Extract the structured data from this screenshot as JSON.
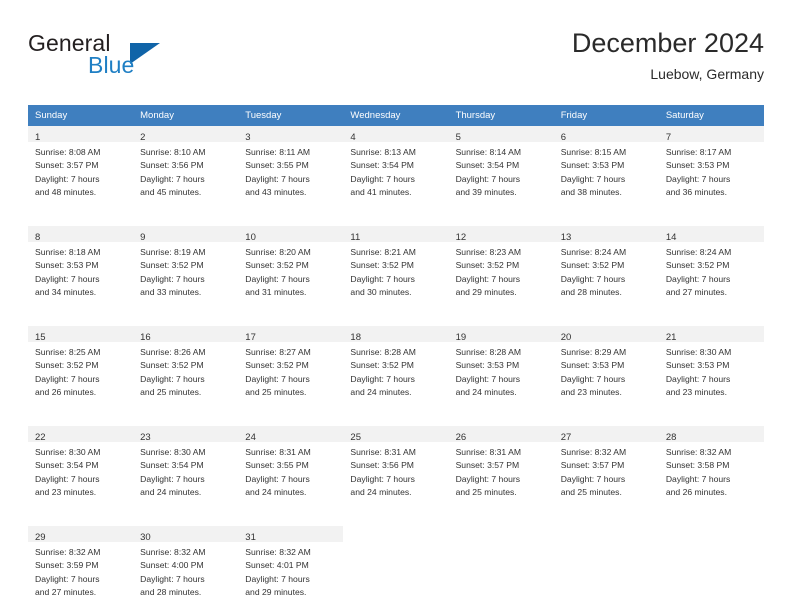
{
  "logo": {
    "word1": "General",
    "word2": "Blue",
    "triangle_color": "#1064a8",
    "blue_color": "#1f7fc4"
  },
  "header": {
    "title": "December 2024",
    "subtitle": "Luebow, Germany"
  },
  "theme": {
    "header_row_bg": "#3f7fbf",
    "daynum_band_bg": "#f2f2f2",
    "text_color": "#333333"
  },
  "weekdays": [
    "Sunday",
    "Monday",
    "Tuesday",
    "Wednesday",
    "Thursday",
    "Friday",
    "Saturday"
  ],
  "weeks": [
    [
      {
        "day": "1",
        "sunrise": "Sunrise: 8:08 AM",
        "sunset": "Sunset: 3:57 PM",
        "daylight1": "Daylight: 7 hours",
        "daylight2": "and 48 minutes."
      },
      {
        "day": "2",
        "sunrise": "Sunrise: 8:10 AM",
        "sunset": "Sunset: 3:56 PM",
        "daylight1": "Daylight: 7 hours",
        "daylight2": "and 45 minutes."
      },
      {
        "day": "3",
        "sunrise": "Sunrise: 8:11 AM",
        "sunset": "Sunset: 3:55 PM",
        "daylight1": "Daylight: 7 hours",
        "daylight2": "and 43 minutes."
      },
      {
        "day": "4",
        "sunrise": "Sunrise: 8:13 AM",
        "sunset": "Sunset: 3:54 PM",
        "daylight1": "Daylight: 7 hours",
        "daylight2": "and 41 minutes."
      },
      {
        "day": "5",
        "sunrise": "Sunrise: 8:14 AM",
        "sunset": "Sunset: 3:54 PM",
        "daylight1": "Daylight: 7 hours",
        "daylight2": "and 39 minutes."
      },
      {
        "day": "6",
        "sunrise": "Sunrise: 8:15 AM",
        "sunset": "Sunset: 3:53 PM",
        "daylight1": "Daylight: 7 hours",
        "daylight2": "and 38 minutes."
      },
      {
        "day": "7",
        "sunrise": "Sunrise: 8:17 AM",
        "sunset": "Sunset: 3:53 PM",
        "daylight1": "Daylight: 7 hours",
        "daylight2": "and 36 minutes."
      }
    ],
    [
      {
        "day": "8",
        "sunrise": "Sunrise: 8:18 AM",
        "sunset": "Sunset: 3:53 PM",
        "daylight1": "Daylight: 7 hours",
        "daylight2": "and 34 minutes."
      },
      {
        "day": "9",
        "sunrise": "Sunrise: 8:19 AM",
        "sunset": "Sunset: 3:52 PM",
        "daylight1": "Daylight: 7 hours",
        "daylight2": "and 33 minutes."
      },
      {
        "day": "10",
        "sunrise": "Sunrise: 8:20 AM",
        "sunset": "Sunset: 3:52 PM",
        "daylight1": "Daylight: 7 hours",
        "daylight2": "and 31 minutes."
      },
      {
        "day": "11",
        "sunrise": "Sunrise: 8:21 AM",
        "sunset": "Sunset: 3:52 PM",
        "daylight1": "Daylight: 7 hours",
        "daylight2": "and 30 minutes."
      },
      {
        "day": "12",
        "sunrise": "Sunrise: 8:23 AM",
        "sunset": "Sunset: 3:52 PM",
        "daylight1": "Daylight: 7 hours",
        "daylight2": "and 29 minutes."
      },
      {
        "day": "13",
        "sunrise": "Sunrise: 8:24 AM",
        "sunset": "Sunset: 3:52 PM",
        "daylight1": "Daylight: 7 hours",
        "daylight2": "and 28 minutes."
      },
      {
        "day": "14",
        "sunrise": "Sunrise: 8:24 AM",
        "sunset": "Sunset: 3:52 PM",
        "daylight1": "Daylight: 7 hours",
        "daylight2": "and 27 minutes."
      }
    ],
    [
      {
        "day": "15",
        "sunrise": "Sunrise: 8:25 AM",
        "sunset": "Sunset: 3:52 PM",
        "daylight1": "Daylight: 7 hours",
        "daylight2": "and 26 minutes."
      },
      {
        "day": "16",
        "sunrise": "Sunrise: 8:26 AM",
        "sunset": "Sunset: 3:52 PM",
        "daylight1": "Daylight: 7 hours",
        "daylight2": "and 25 minutes."
      },
      {
        "day": "17",
        "sunrise": "Sunrise: 8:27 AM",
        "sunset": "Sunset: 3:52 PM",
        "daylight1": "Daylight: 7 hours",
        "daylight2": "and 25 minutes."
      },
      {
        "day": "18",
        "sunrise": "Sunrise: 8:28 AM",
        "sunset": "Sunset: 3:52 PM",
        "daylight1": "Daylight: 7 hours",
        "daylight2": "and 24 minutes."
      },
      {
        "day": "19",
        "sunrise": "Sunrise: 8:28 AM",
        "sunset": "Sunset: 3:53 PM",
        "daylight1": "Daylight: 7 hours",
        "daylight2": "and 24 minutes."
      },
      {
        "day": "20",
        "sunrise": "Sunrise: 8:29 AM",
        "sunset": "Sunset: 3:53 PM",
        "daylight1": "Daylight: 7 hours",
        "daylight2": "and 23 minutes."
      },
      {
        "day": "21",
        "sunrise": "Sunrise: 8:30 AM",
        "sunset": "Sunset: 3:53 PM",
        "daylight1": "Daylight: 7 hours",
        "daylight2": "and 23 minutes."
      }
    ],
    [
      {
        "day": "22",
        "sunrise": "Sunrise: 8:30 AM",
        "sunset": "Sunset: 3:54 PM",
        "daylight1": "Daylight: 7 hours",
        "daylight2": "and 23 minutes."
      },
      {
        "day": "23",
        "sunrise": "Sunrise: 8:30 AM",
        "sunset": "Sunset: 3:54 PM",
        "daylight1": "Daylight: 7 hours",
        "daylight2": "and 24 minutes."
      },
      {
        "day": "24",
        "sunrise": "Sunrise: 8:31 AM",
        "sunset": "Sunset: 3:55 PM",
        "daylight1": "Daylight: 7 hours",
        "daylight2": "and 24 minutes."
      },
      {
        "day": "25",
        "sunrise": "Sunrise: 8:31 AM",
        "sunset": "Sunset: 3:56 PM",
        "daylight1": "Daylight: 7 hours",
        "daylight2": "and 24 minutes."
      },
      {
        "day": "26",
        "sunrise": "Sunrise: 8:31 AM",
        "sunset": "Sunset: 3:57 PM",
        "daylight1": "Daylight: 7 hours",
        "daylight2": "and 25 minutes."
      },
      {
        "day": "27",
        "sunrise": "Sunrise: 8:32 AM",
        "sunset": "Sunset: 3:57 PM",
        "daylight1": "Daylight: 7 hours",
        "daylight2": "and 25 minutes."
      },
      {
        "day": "28",
        "sunrise": "Sunrise: 8:32 AM",
        "sunset": "Sunset: 3:58 PM",
        "daylight1": "Daylight: 7 hours",
        "daylight2": "and 26 minutes."
      }
    ],
    [
      {
        "day": "29",
        "sunrise": "Sunrise: 8:32 AM",
        "sunset": "Sunset: 3:59 PM",
        "daylight1": "Daylight: 7 hours",
        "daylight2": "and 27 minutes."
      },
      {
        "day": "30",
        "sunrise": "Sunrise: 8:32 AM",
        "sunset": "Sunset: 4:00 PM",
        "daylight1": "Daylight: 7 hours",
        "daylight2": "and 28 minutes."
      },
      {
        "day": "31",
        "sunrise": "Sunrise: 8:32 AM",
        "sunset": "Sunset: 4:01 PM",
        "daylight1": "Daylight: 7 hours",
        "daylight2": "and 29 minutes."
      },
      {
        "day": "",
        "sunrise": "",
        "sunset": "",
        "daylight1": "",
        "daylight2": ""
      },
      {
        "day": "",
        "sunrise": "",
        "sunset": "",
        "daylight1": "",
        "daylight2": ""
      },
      {
        "day": "",
        "sunrise": "",
        "sunset": "",
        "daylight1": "",
        "daylight2": ""
      },
      {
        "day": "",
        "sunrise": "",
        "sunset": "",
        "daylight1": "",
        "daylight2": ""
      }
    ]
  ]
}
